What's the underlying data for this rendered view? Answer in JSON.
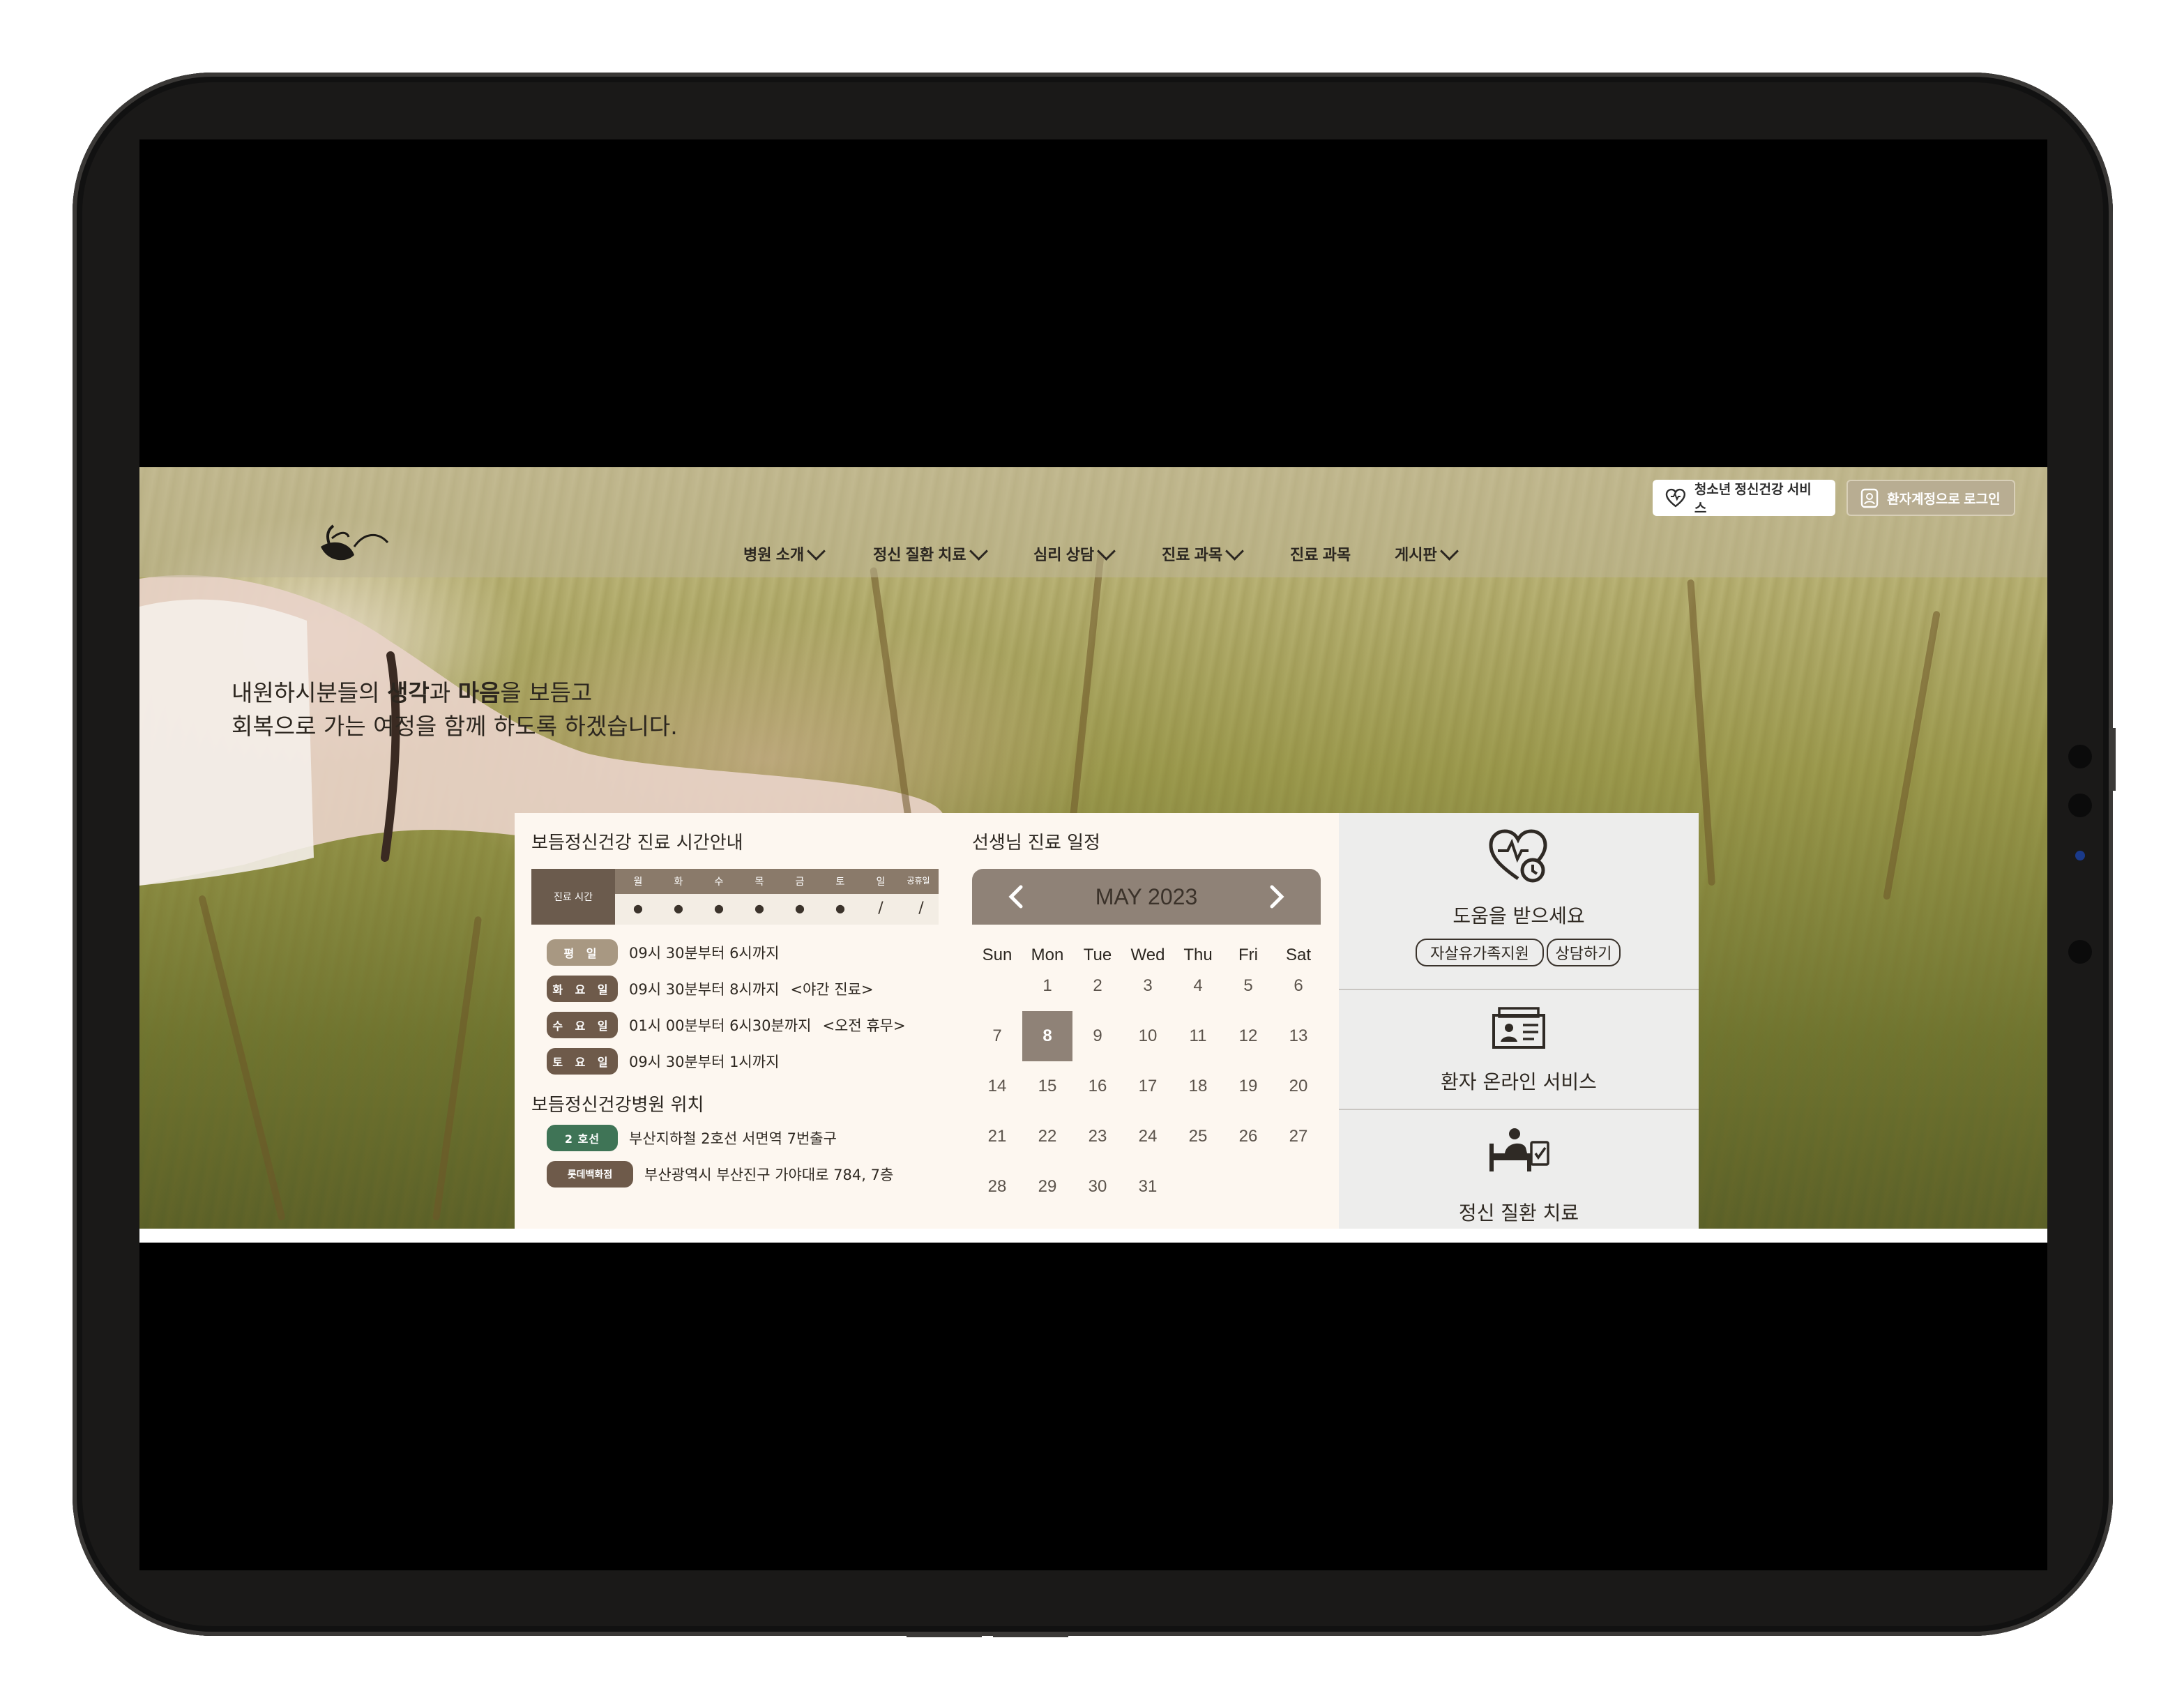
{
  "header": {
    "pill_youth": "청소년 정신건강 서비스",
    "pill_login": "환자계정으로 로그인"
  },
  "nav": [
    {
      "label": "병원 소개",
      "dropdown": true
    },
    {
      "label": "정신 질환 치료",
      "dropdown": true
    },
    {
      "label": "심리 상담",
      "dropdown": true
    },
    {
      "label": "진료 과목",
      "dropdown": true
    },
    {
      "label": "진료 과목",
      "dropdown": false
    },
    {
      "label": "게시판",
      "dropdown": true
    }
  ],
  "hero": {
    "line1_a": "내원하시분들의 ",
    "line1_b": "생각",
    "line1_c": "과 ",
    "line1_d": "마음",
    "line1_e": "을 보듬고",
    "line2": "회복으로 가는 여정을 함께 하도록 하겠습니다."
  },
  "hours": {
    "title": "보듬정신건강 진료 시간안내",
    "head_label": "진료 시간",
    "days": [
      "월",
      "화",
      "수",
      "목",
      "금",
      "토",
      "일",
      "공휴일"
    ],
    "marks": [
      "●",
      "●",
      "●",
      "●",
      "●",
      "●",
      "/",
      "/"
    ],
    "rows": [
      {
        "badge": "평 일",
        "text": "09시 30분부터 6시까지",
        "note": ""
      },
      {
        "badge": "화 요 일",
        "text": "09시 30분부터 8시까지",
        "note": "<야간 진료>"
      },
      {
        "badge": "수 요 일",
        "text": "01시 00분부터 6시30분까지",
        "note": "<오전 휴무>"
      },
      {
        "badge": "토 요 일",
        "text": "09시 30분부터 1시까지",
        "note": ""
      }
    ],
    "location_title": "보듬정신건강병원 위치",
    "locations": [
      {
        "badge": "2 호선",
        "text": "부산지하철 2호선 서면역 7번출구"
      },
      {
        "badge": "롯데백화점",
        "text": "부산광역시 부산진구 가야대로 784, 7층"
      }
    ]
  },
  "calendar": {
    "title": "선생님 진료 일정",
    "month": "MAY 2023",
    "weekdays": [
      "Sun",
      "Mon",
      "Tue",
      "Wed",
      "Thu",
      "Fri",
      "Sat"
    ],
    "weeks": [
      [
        "",
        "1",
        "2",
        "3",
        "4",
        "5",
        "6"
      ],
      [
        "7",
        "8",
        "9",
        "10",
        "11",
        "12",
        "13"
      ],
      [
        "14",
        "15",
        "16",
        "17",
        "18",
        "19",
        "20"
      ],
      [
        "21",
        "22",
        "23",
        "24",
        "25",
        "26",
        "27"
      ],
      [
        "28",
        "29",
        "30",
        "31",
        "",
        "",
        ""
      ]
    ],
    "selected": "8"
  },
  "services": {
    "help_title": "도움을 받으세요",
    "btn_family": "자살유가족지원",
    "btn_counsel": "상담하기",
    "online_title": "환자 온라인 서비스",
    "treatment_title": "정신 질환 치료"
  },
  "icons": {
    "youth": "brain-heart-icon",
    "login": "id-badge-icon",
    "help": "heart-clock-icon",
    "online": "patient-record-icon",
    "treatment": "hospital-bed-icon"
  },
  "colors": {
    "accent_brown": "#8f8277",
    "badge_dark": "#6e5a4a",
    "badge_green": "#3f7456",
    "panel_bg": "#fdf7f0"
  }
}
